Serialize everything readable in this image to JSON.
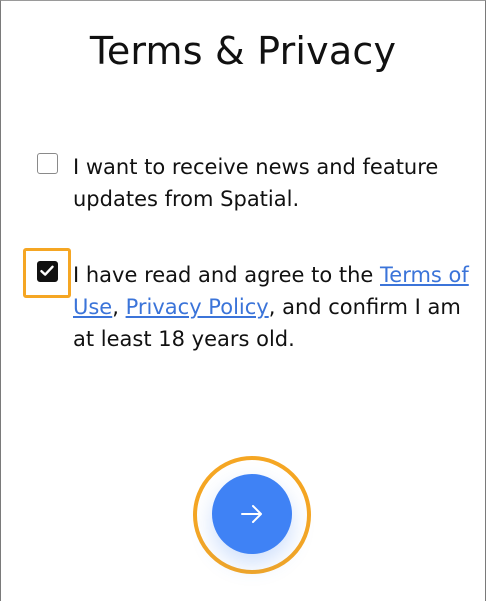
{
  "title": "Terms & Privacy",
  "options": {
    "news": {
      "checked": false,
      "text": "I want to receive news and feature updates from Spatial."
    },
    "terms": {
      "checked": true,
      "prefix": "I have read and agree to the ",
      "terms_link": "Terms of Use",
      "separator": ", ",
      "privacy_link": "Privacy Policy",
      "suffix": ", and confirm I am at least 18 years old."
    }
  },
  "next_button": {
    "icon": "arrow-right-icon"
  },
  "colors": {
    "link": "#3b74d9",
    "accent": "#3f82f5",
    "focus": "#f5a623"
  }
}
